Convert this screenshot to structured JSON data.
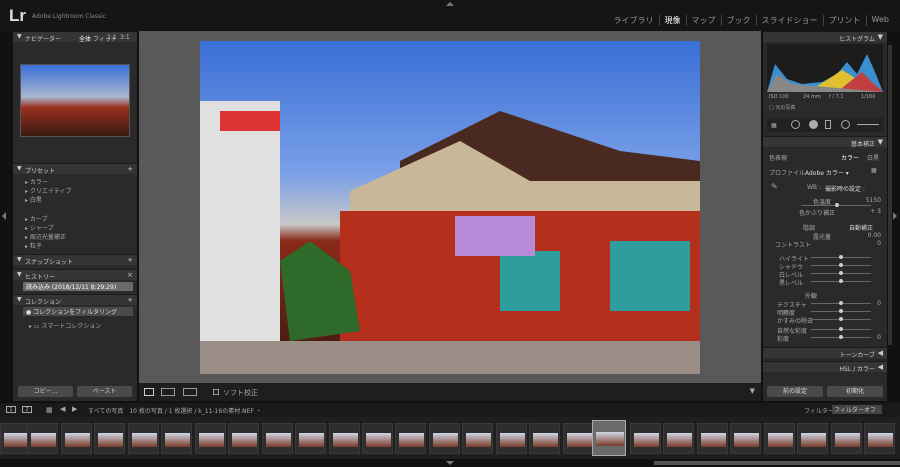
{
  "app": {
    "logo": "Lr",
    "name": "Adobe Lightroom Classic"
  },
  "modules": [
    {
      "label": "ライブラリ",
      "active": false
    },
    {
      "label": "現像",
      "active": true
    },
    {
      "label": "マップ",
      "active": false
    },
    {
      "label": "ブック",
      "active": false
    },
    {
      "label": "スライドショー",
      "active": false
    },
    {
      "label": "プリント",
      "active": false
    },
    {
      "label": "Web",
      "active": false
    }
  ],
  "left": {
    "navigator": {
      "title": "ナビゲーター",
      "zoom": [
        "全体",
        "フィット",
        "1:1",
        "3:1"
      ]
    },
    "presets": {
      "title": "プリセット",
      "items": [
        "カラー",
        "クリエイティブ",
        "白黒",
        "カーブ",
        "シャープ",
        "周辺光量補正",
        "粒子"
      ]
    },
    "snapshots": {
      "title": "スナップショット"
    },
    "history": {
      "title": "ヒストリー",
      "item": "読み込み (2018/12/11 8:29:29)"
    },
    "collections": {
      "title": "コレクション",
      "items": [
        "コレクションをフィルタリング",
        "スマートコレクション"
      ]
    },
    "copy": "コピー...",
    "paste": "ペースト"
  },
  "toolbar": {
    "softproof": "ソフト校正"
  },
  "right": {
    "histogram": {
      "title": "ヒストグラム",
      "readout": [
        "ISO 100",
        "24 mm",
        "f / 7.1",
        "1/160"
      ],
      "original": "元の写真"
    },
    "basic": {
      "title": "基本補正",
      "treatment": "色表現",
      "color": "カラー",
      "bw": "白黒",
      "profile_label": "プロファイル",
      "profile": "Adobe カラー",
      "wb": "WB :",
      "wb_value": "撮影時の設定 :",
      "temp": "色温度",
      "temp_val": "5150",
      "tint": "色かぶり補正",
      "tint_val": "+ 3",
      "tone": "階調",
      "auto": "自動補正",
      "exposure": "露光量",
      "exposure_val": "0.00",
      "contrast": "コントラスト",
      "contrast_val": "0",
      "highlights": "ハイライト",
      "shadows": "シャドウ",
      "whites": "白レベル",
      "blacks": "黒レベル",
      "presence": "外観",
      "texture": "テクスチャ",
      "clarity": "明瞭度",
      "dehaze": "かすみの除去",
      "vibrance": "自然な彩度",
      "saturation": "彩度",
      "zero": "0"
    },
    "tonecurve": "トーンカーブ",
    "hsl": "HSL / カラー",
    "prev": "前の設定",
    "reset": "初期化"
  },
  "filmstrip": {
    "path": "すべての写真　10 枚の写真 / 1 枚選択 / k_11-16の素材.NEF ・",
    "filter": "フィルター :",
    "filter_val": "フィルターオフ"
  },
  "colors": {
    "accent": "#4a8ee0"
  }
}
